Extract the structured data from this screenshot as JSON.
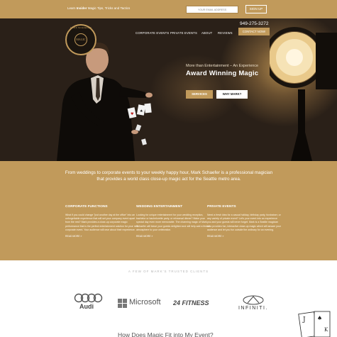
{
  "topbar": {
    "tagline_prefix": "Learn ",
    "tagline_bold": "Insider",
    "tagline_suffix": " Magic Tips, Tricks and Tactics",
    "email_placeholder": "YOUR EMAIL ADDRESS",
    "signup_label": "SIGN UP"
  },
  "logo": {
    "ring_text": "MARK SCHAEFER",
    "inner_text": "MAGIC"
  },
  "nav": {
    "items": [
      "CORPORATE EVENTS",
      "PRIVATE EVENTS",
      "ABOUT",
      "REVIEWS"
    ],
    "phone": "949-275-3272",
    "contact_label": "CONTACT NOW!"
  },
  "hero": {
    "kicker": "More than Entertainment – An Experience",
    "title": "Award Winning Magic",
    "services_label": "SERVICES",
    "why_label": "WHY MARK?"
  },
  "intro": "From weddings to corporate events to your weekly happy hour, Mark Schaefer is a professional magician that provides a world class close-up magic act for the Seattle metro area.",
  "columns": [
    {
      "heading": "CORPORATE FUNCTIONS",
      "text": "What if you could change \"just another day at the office\" into an unforgettable experience that will set your company event apart from the rest? Mark provides a close-up corporate magic performance that is the perfect entertainment solution for your next corporate event. Your audience will rave about their experience.",
      "more": "READ MORE »"
    },
    {
      "heading": "WEDDING ENTERTAINMENT",
      "text": "Looking for unique entertainment for your wedding reception, bachelor or bachelorette party, or rehearsal dinner? Make your special day even more memorable. The charming magic of Mark Schaefer will leave your guests delighted and will help add a festive atmosphere to your celebration.",
      "more": "READ MORE »"
    },
    {
      "heading": "PRIVATE EVENTS",
      "text": "Need a fresh idea for a casual holiday, birthday party, fundraiser, or any variety of private event? Let's your event into an experience you and your guests will never forget. Mark is a Seattle magician who provides fun, interactive close-up magic which will amaze your audience and let you fun outside the ordinary for an evening.",
      "more": "READ MORE »"
    }
  ],
  "clients": {
    "label": "A FEW OF MARK'S TRUSTED CLIENTS",
    "logos": [
      "Audi",
      "Microsoft",
      "24 FITNESS",
      "INFINITI."
    ]
  },
  "bottom_heading": "How Does Magic Fit into My Event?",
  "colors": {
    "gold": "#c19a5b",
    "dark": "#1b150f"
  }
}
